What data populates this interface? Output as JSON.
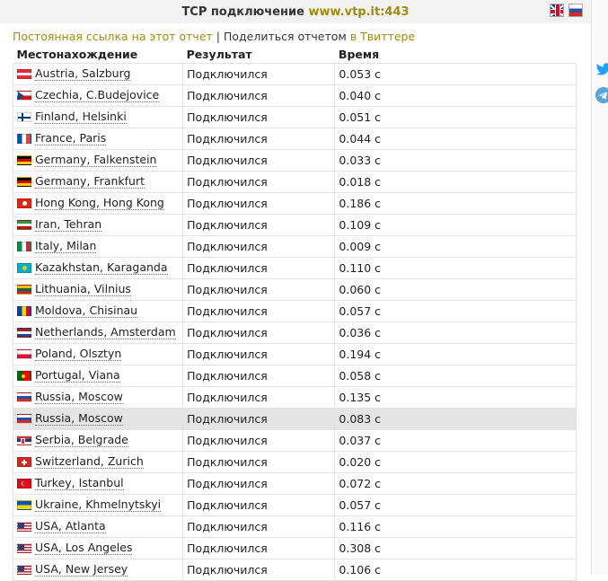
{
  "title": {
    "prefix": "TCP подключение",
    "host": "www.vtp.it:443"
  },
  "share": {
    "permalink": "Постоянная ссылка на этот отчет",
    "sep": " | ",
    "share_text": "Поделиться отчетом ",
    "twitter": "в Твиттере"
  },
  "headers": [
    "Местонахождение",
    "Результат",
    "Время"
  ],
  "rows": [
    {
      "location": "Austria, Salzburg",
      "result": "Подключился",
      "time": "0.053 с",
      "flag": "at"
    },
    {
      "location": "Czechia, C.Budejovice",
      "result": "Подключился",
      "time": "0.040 с",
      "flag": "cz"
    },
    {
      "location": "Finland, Helsinki",
      "result": "Подключился",
      "time": "0.051 с",
      "flag": "fi"
    },
    {
      "location": "France, Paris",
      "result": "Подключился",
      "time": "0.044 с",
      "flag": "fr"
    },
    {
      "location": "Germany, Falkenstein",
      "result": "Подключился",
      "time": "0.033 с",
      "flag": "de"
    },
    {
      "location": "Germany, Frankfurt",
      "result": "Подключился",
      "time": "0.018 с",
      "flag": "de"
    },
    {
      "location": "Hong Kong, Hong Kong",
      "result": "Подключился",
      "time": "0.186 с",
      "flag": "hk"
    },
    {
      "location": "Iran, Tehran",
      "result": "Подключился",
      "time": "0.109 с",
      "flag": "ir"
    },
    {
      "location": "Italy, Milan",
      "result": "Подключился",
      "time": "0.009 с",
      "flag": "it"
    },
    {
      "location": "Kazakhstan, Karaganda",
      "result": "Подключился",
      "time": "0.110 с",
      "flag": "kz"
    },
    {
      "location": "Lithuania, Vilnius",
      "result": "Подключился",
      "time": "0.060 с",
      "flag": "lt"
    },
    {
      "location": "Moldova, Chisinau",
      "result": "Подключился",
      "time": "0.057 с",
      "flag": "md"
    },
    {
      "location": "Netherlands, Amsterdam",
      "result": "Подключился",
      "time": "0.036 с",
      "flag": "nl"
    },
    {
      "location": "Poland, Olsztyn",
      "result": "Подключился",
      "time": "0.194 с",
      "flag": "pl"
    },
    {
      "location": "Portugal, Viana",
      "result": "Подключился",
      "time": "0.058 с",
      "flag": "pt"
    },
    {
      "location": "Russia, Moscow",
      "result": "Подключился",
      "time": "0.135 с",
      "flag": "ru"
    },
    {
      "location": "Russia, Moscow",
      "result": "Подключился",
      "time": "0.083 с",
      "flag": "ru",
      "highlight": true
    },
    {
      "location": "Serbia, Belgrade",
      "result": "Подключился",
      "time": "0.037 с",
      "flag": "rs"
    },
    {
      "location": "Switzerland, Zurich",
      "result": "Подключился",
      "time": "0.020 с",
      "flag": "ch"
    },
    {
      "location": "Turkey, Istanbul",
      "result": "Подключился",
      "time": "0.072 с",
      "flag": "tr"
    },
    {
      "location": "Ukraine, Khmelnytskyi",
      "result": "Подключился",
      "time": "0.057 с",
      "flag": "ua"
    },
    {
      "location": "USA, Atlanta",
      "result": "Подключился",
      "time": "0.116 с",
      "flag": "us"
    },
    {
      "location": "USA, Los Angeles",
      "result": "Подключился",
      "time": "0.308 с",
      "flag": "us"
    },
    {
      "location": "USA, New Jersey",
      "result": "Подключился",
      "time": "0.106 с",
      "flag": "us"
    }
  ],
  "icons": {
    "lang_en": "uk-flag-icon",
    "lang_ru": "russia-flag-icon",
    "twitter": "twitter-icon",
    "telegram": "telegram-icon"
  },
  "colors": {
    "title_host": "#a08a10",
    "link": "#a08a10",
    "highlight_row": "#e5e5e5"
  }
}
